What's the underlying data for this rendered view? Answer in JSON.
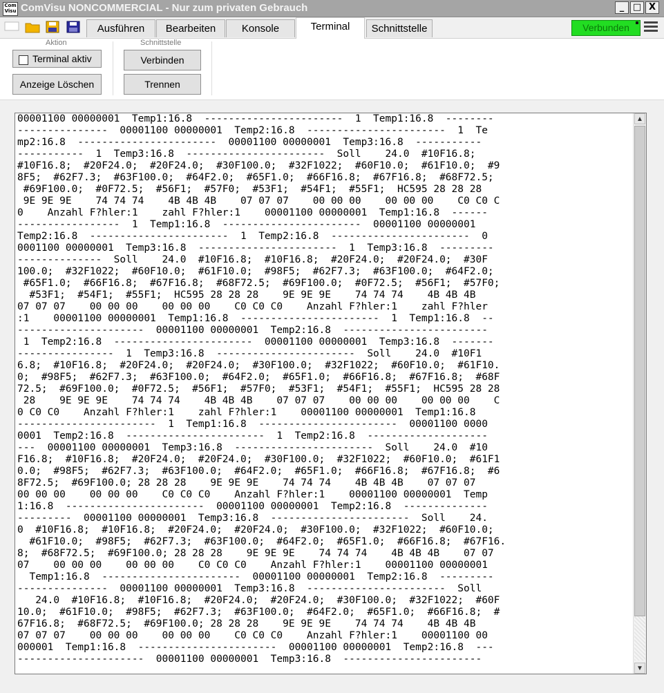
{
  "window": {
    "title": "ComVisu NONCOMMERCIAL - Nur zum privaten Gebrauch",
    "app_icon_text": "Com Visu",
    "minimize": "_",
    "maximize": "□",
    "close": "X"
  },
  "toolbar": {
    "icons": [
      "new-file-icon",
      "open-folder-icon",
      "save-icon",
      "save-as-icon"
    ],
    "tabs": [
      {
        "label": "Ausführen",
        "active": false
      },
      {
        "label": "Bearbeiten",
        "active": false
      },
      {
        "label": "Konsole",
        "active": false
      },
      {
        "label": "Terminal",
        "active": true
      },
      {
        "label": "Schnittstelle",
        "active": false
      }
    ],
    "status": "Verbunden",
    "status_color": "#22dd22"
  },
  "ribbon": {
    "aktion": {
      "label": "Aktion",
      "terminal_checkbox_label": "Terminal aktiv",
      "terminal_checked": false,
      "clear_button": "Anzeige Löschen"
    },
    "schnittstelle": {
      "label": "Schnittstelle",
      "connect_button": "Verbinden",
      "disconnect_button": "Trennen"
    }
  },
  "terminal": {
    "lines": [
      "00001100 00000001  Temp1:16.8  -----------------------  1  Temp1:16.8  --------",
      "---------------  00001100 00000001  Temp2:16.8  -----------------------  1  Te",
      "mp2:16.8  -----------------------  00001100 00000001  Temp3:16.8  -----------",
      "-----------  1  Temp3:16.8  -----------------------  Soll    24.0  #10F16.8;",
      "#10F16.8;  #20F24.0;  #20F24.0;  #30F100.0;  #32F1022;  #60F10.0;  #61F10.0;  #9",
      "8F5;  #62F7.3;  #63F100.0;  #64F2.0;  #65F1.0;  #66F16.8;  #67F16.8;  #68F72.5;",
      " #69F100.0;  #0F72.5;  #56F1;  #57F0;  #53F1;  #54F1;  #55F1;  HC595 28 28 28",
      " 9E 9E 9E    74 74 74    4B 4B 4B    07 07 07    00 00 00    00 00 00    C0 C0 C",
      "0    Anzahl F?hler:1    zahl F?hler:1    00001100 00000001  Temp1:16.8  ------",
      "-----------------  1  Temp1:16.8  -----------------------  00001100 00000001",
      "Temp2:16.8  -----------------------  1  Temp2:16.8  -----------------------  0",
      "0001100 00000001  Temp3:16.8  -----------------------  1  Temp3:16.8  ---------",
      "--------------  Soll    24.0  #10F16.8;  #10F16.8;  #20F24.0;  #20F24.0;  #30F",
      "100.0;  #32F1022;  #60F10.0;  #61F10.0;  #98F5;  #62F7.3;  #63F100.0;  #64F2.0;",
      " #65F1.0;  #66F16.8;  #67F16.8;  #68F72.5;  #69F100.0;  #0F72.5;  #56F1;  #57F0;",
      "  #53F1;  #54F1;  #55F1;  HC595 28 28 28    9E 9E 9E    74 74 74    4B 4B 4B",
      "07 07 07    00 00 00    00 00 00    C0 C0 C0    Anzahl F?hler:1    zahl F?hler",
      ":1    00001100 00000001  Temp1:16.8  -----------------------  1  Temp1:16.8  --",
      "---------------------  00001100 00000001  Temp2:16.8  ------------------------",
      " 1  Temp2:16.8  -----------------------  00001100 00000001  Temp3:16.8  -------",
      "----------------  1  Temp3:16.8  -----------------------  Soll    24.0  #10F1",
      "6.8;  #10F16.8;  #20F24.0;  #20F24.0;  #30F100.0;  #32F1022;  #60F10.0;  #61F10.",
      "0;  #98F5;  #62F7.3;  #63F100.0;  #64F2.0;  #65F1.0;  #66F16.8;  #67F16.8;  #68F",
      "72.5;  #69F100.0;  #0F72.5;  #56F1;  #57F0;  #53F1;  #54F1;  #55F1;  HC595 28 28",
      " 28    9E 9E 9E    74 74 74    4B 4B 4B    07 07 07    00 00 00    00 00 00    C",
      "0 C0 C0    Anzahl F?hler:1    zahl F?hler:1    00001100 00000001  Temp1:16.8",
      "-----------------------  1  Temp1:16.8  -----------------------  00001100 0000",
      "0001  Temp2:16.8  -----------------------  1  Temp2:16.8  --------------------",
      "---  00001100 00000001  Temp3:16.8  -----------------------  Soll    24.0  #10",
      "F16.8;  #10F16.8;  #20F24.0;  #20F24.0;  #30F100.0;  #32F1022;  #60F10.0;  #61F1",
      "0.0;  #98F5;  #62F7.3;  #63F100.0;  #64F2.0;  #65F1.0;  #66F16.8;  #67F16.8;  #6",
      "8F72.5;  #69F100.0; 28 28 28    9E 9E 9E    74 74 74    4B 4B 4B    07 07 07",
      "00 00 00    00 00 00    C0 C0 C0    Anzahl F?hler:1    00001100 00000001  Temp",
      "1:16.8  -----------------------  00001100 00000001  Temp2:16.8  --------------",
      "---------  00001100 00000001  Temp3:16.8  -----------------------  Soll    24.",
      "0  #10F16.8;  #10F16.8;  #20F24.0;  #20F24.0;  #30F100.0;  #32F1022;  #60F10.0;",
      "  #61F10.0;  #98F5;  #62F7.3;  #63F100.0;  #64F2.0;  #65F1.0;  #66F16.8;  #67F16.",
      "8;  #68F72.5;  #69F100.0; 28 28 28    9E 9E 9E    74 74 74    4B 4B 4B    07 07",
      "07    00 00 00    00 00 00    C0 C0 C0    Anzahl F?hler:1    00001100 00000001",
      "  Temp1:16.8  -----------------------  00001100 00000001  Temp2:16.8  ---------",
      "---------------  00001100 00000001  Temp3:16.8  -----------------------  Soll",
      "   24.0  #10F16.8;  #10F16.8;  #20F24.0;  #20F24.0;  #30F100.0;  #32F1022;  #60F",
      "10.0;  #61F10.0;  #98F5;  #62F7.3;  #63F100.0;  #64F2.0;  #65F1.0;  #66F16.8;  #",
      "67F16.8;  #68F72.5;  #69F100.0; 28 28 28    9E 9E 9E    74 74 74    4B 4B 4B",
      "07 07 07    00 00 00    00 00 00    C0 C0 C0    Anzahl F?hler:1    00001100 00",
      "000001  Temp1:16.8  -----------------------  00001100 00000001  Temp2:16.8  ---",
      "---------------------  00001100 00000001  Temp3:16.8  -----------------------"
    ]
  }
}
